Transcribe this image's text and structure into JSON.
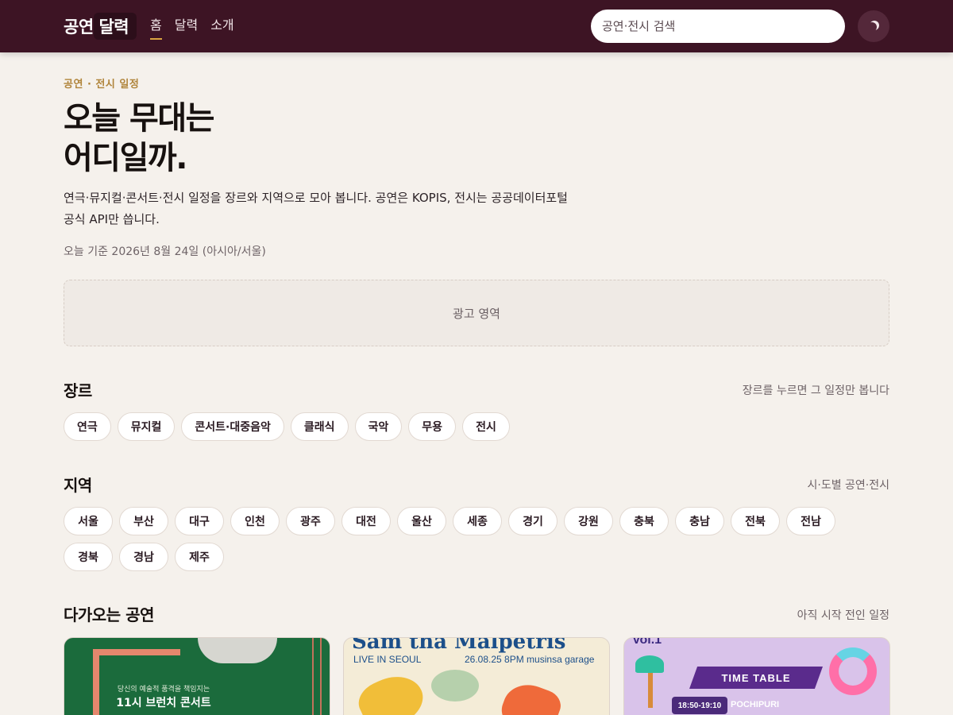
{
  "header": {
    "brand": "공연 달력",
    "nav": [
      {
        "label": "홈",
        "active": true
      },
      {
        "label": "달력",
        "active": false
      },
      {
        "label": "소개",
        "active": false
      }
    ],
    "search_placeholder": "공연·전시 검색",
    "theme_icon": "moon-icon"
  },
  "hero": {
    "eyebrow": "공연 · 전시 일정",
    "title_line1": "오늘 무대는",
    "title_line2": "어디일까.",
    "description": "연극·뮤지컬·콘서트·전시 일정을 장르와 지역으로 모아 봅니다. 공연은 KOPIS, 전시는 공공데이터포털 공식 API만 씁니다.",
    "date_line": "오늘 기준 2026년 8월 24일 (아시아/서울)"
  },
  "ad": {
    "label": "광고 영역"
  },
  "genre": {
    "title": "장르",
    "note": "장르를 누르면 그 일정만 봅니다",
    "items": [
      "연극",
      "뮤지컬",
      "콘서트·대중음악",
      "클래식",
      "국악",
      "무용",
      "전시"
    ]
  },
  "region": {
    "title": "지역",
    "note": "시·도별 공연·전시",
    "items": [
      "서울",
      "부산",
      "대구",
      "인천",
      "광주",
      "대전",
      "울산",
      "세종",
      "경기",
      "강원",
      "충북",
      "충남",
      "전북",
      "전남",
      "경북",
      "경남",
      "제주"
    ]
  },
  "upcoming": {
    "title": "다가오는 공연",
    "note": "아직 시작 전인 일정",
    "cards": [
      {
        "poster_line1": "당신의 예술적 품격을 책임지는",
        "poster_line2": "11시 브런치 콘서트",
        "colors": {
          "bg": "#1b6b3c",
          "accent": "#e5876d"
        }
      },
      {
        "poster_title": "Sam tha Malpetris",
        "poster_sub": "LIVE IN SEOUL",
        "poster_date": "26.08.25  8PM musinsa garage",
        "colors": {
          "bg": "#f4ecd7",
          "accent": "#1c4f8a"
        }
      },
      {
        "poster_top": "Vol.1",
        "poster_banner": "TIME TABLE",
        "poster_time": "18:50-19:10",
        "poster_act": "POCHIPURI",
        "colors": {
          "bg": "#d9c3ea",
          "accent": "#5a2b8c"
        }
      }
    ]
  }
}
